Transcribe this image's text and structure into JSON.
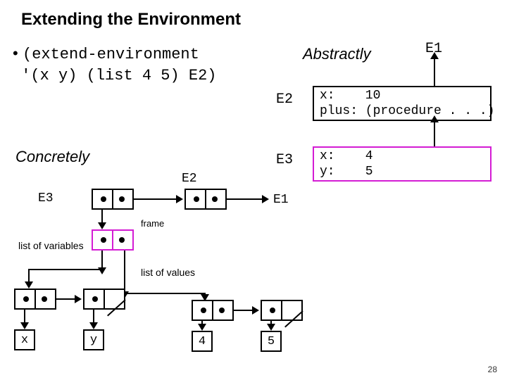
{
  "title": "Extending the Environment",
  "bullet_code_line1": "(extend-environment",
  "bullet_code_line2": "'(x y) (list 4 5) E2)",
  "abstract_label": "Abstractly",
  "concrete_label": "Concretely",
  "labels": {
    "E1": "E1",
    "E2": "E2",
    "E3": "E3"
  },
  "frame_e2_text": "x:    10\nplus: (procedure . . .)",
  "frame_e3_text": "x:    4\ny:    5",
  "small_labels": {
    "frame": "frame",
    "vars": "list of\nvariables",
    "vals": "list of\nvalues"
  },
  "values": {
    "x": "x",
    "y": "y",
    "v4": "4",
    "v5": "5"
  },
  "page": "28",
  "chart_data": {
    "type": "table",
    "description": "Environment extension diagram: abstract frames and concrete cons-cell list structure",
    "abstract_frames": [
      {
        "name": "E1",
        "parent": null
      },
      {
        "name": "E2",
        "parent": "E1",
        "bindings": {
          "x": 10,
          "plus": "(procedure . . .)"
        }
      },
      {
        "name": "E3",
        "parent": "E2",
        "bindings": {
          "x": 4,
          "y": 5
        }
      }
    ],
    "concrete": {
      "environment_list": [
        "E3-frame",
        "E2-frame",
        "E1-..."
      ],
      "E3_frame": {
        "variables": [
          "x",
          "y"
        ],
        "values": [
          4,
          5
        ]
      }
    },
    "call": "(extend-environment '(x y) (list 4 5) E2)"
  }
}
